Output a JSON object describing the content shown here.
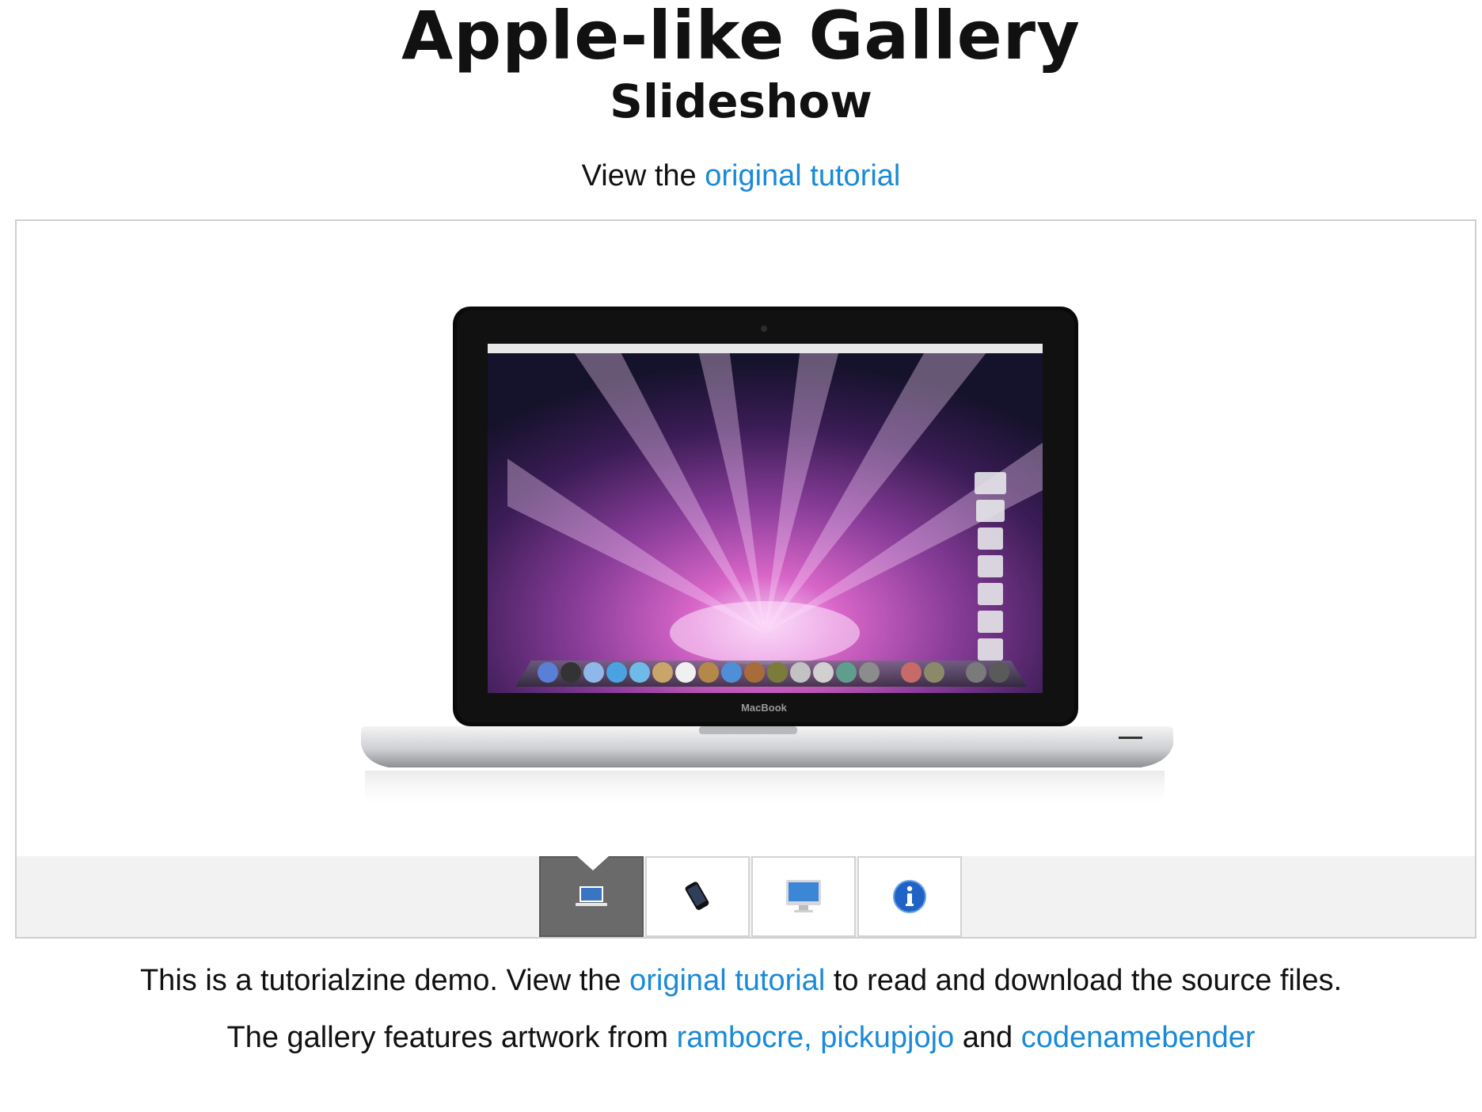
{
  "header": {
    "title": "Apple-like Gallery",
    "subtitle": "Slideshow",
    "view_prefix": "View the ",
    "view_link": "original tutorial"
  },
  "slideshow": {
    "active_index": 0,
    "slide": {
      "device_label": "MacBook",
      "icon": "macbook-image"
    },
    "thumbnails": [
      {
        "icon": "laptop-icon",
        "active": true
      },
      {
        "icon": "iphone-icon",
        "active": false
      },
      {
        "icon": "imac-icon",
        "active": false
      },
      {
        "icon": "info-icon",
        "active": false
      }
    ]
  },
  "footer": {
    "line1_prefix": "This is a tutorialzine demo. View the ",
    "line1_link": "original tutorial",
    "line1_suffix": " to read and download the source files.",
    "line2_prefix": "The gallery features artwork from ",
    "line2_link1": "rambocre,",
    "line2_sep": " ",
    "line2_link2": "pickupjojo",
    "line2_mid": " and ",
    "line2_link3": "codenamebender"
  },
  "colors": {
    "link": "#1a8ad6",
    "active_thumb": "#6a6a6a",
    "thumbbar": "#f2f2f2"
  }
}
